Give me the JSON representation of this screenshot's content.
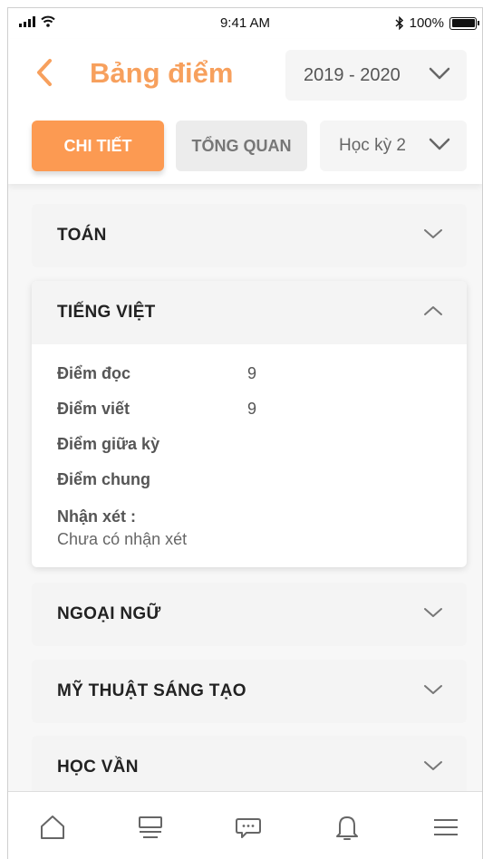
{
  "status_bar": {
    "time": "9:41 AM",
    "battery": "100%"
  },
  "header": {
    "title": "Bảng điểm",
    "year": "2019 - 2020",
    "tab_detail": "CHI TIẾT",
    "tab_overview": "TỔNG QUAN",
    "term": "Học kỳ 2"
  },
  "subjects": [
    {
      "name": "TOÁN",
      "expanded": false
    },
    {
      "name": "TIẾNG VIỆT",
      "expanded": true,
      "scores": [
        {
          "label": "Điểm đọc",
          "value": "9"
        },
        {
          "label": "Điểm viết",
          "value": "9"
        },
        {
          "label": "Điểm giữa kỳ",
          "value": ""
        },
        {
          "label": "Điểm chung",
          "value": ""
        }
      ],
      "comment_label": "Nhận xét :",
      "comment_value": "Chưa có nhận xét"
    },
    {
      "name": "NGOẠI NGỮ",
      "expanded": false
    },
    {
      "name": "MỸ THUẬT SÁNG TẠO",
      "expanded": false
    },
    {
      "name": "HỌC VẦN",
      "expanded": false
    }
  ],
  "bottom_nav": [
    "home-icon",
    "list-icon",
    "chat-icon",
    "bell-icon",
    "menu-icon"
  ],
  "colors": {
    "accent": "#fc9a52",
    "title": "#f7a05d"
  }
}
